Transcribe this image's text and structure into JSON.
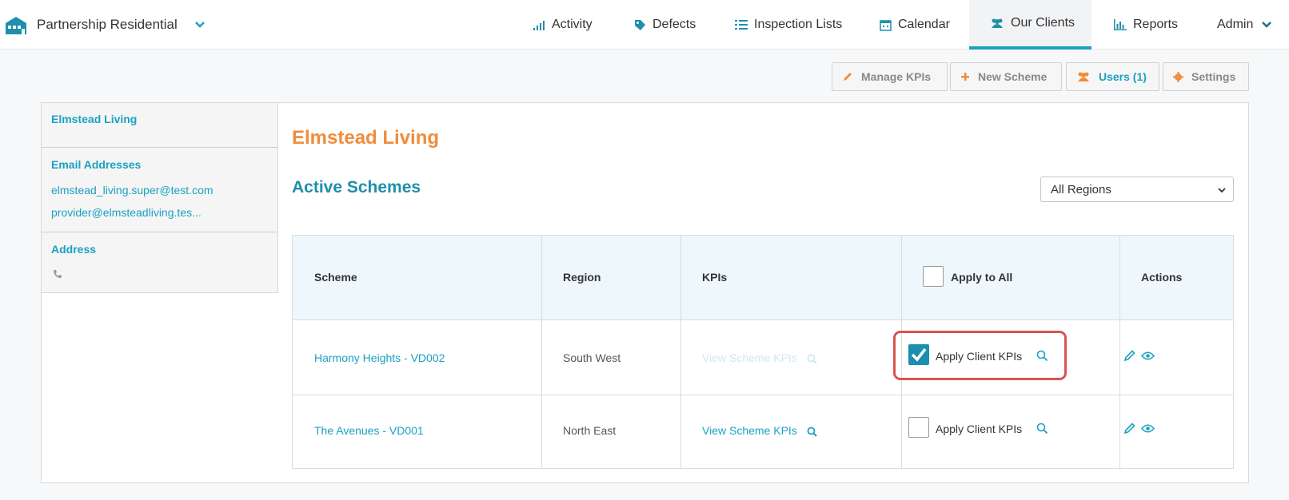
{
  "nav": {
    "org_name": "Partnership Residential",
    "items": [
      {
        "label": "Activity",
        "icon": "activity-icon"
      },
      {
        "label": "Defects",
        "icon": "tag-icon"
      },
      {
        "label": "Inspection Lists",
        "icon": "list-icon"
      },
      {
        "label": "Calendar",
        "icon": "calendar-icon"
      },
      {
        "label": "Our Clients",
        "icon": "users-icon",
        "active": true
      },
      {
        "label": "Reports",
        "icon": "bar-chart-icon"
      },
      {
        "label": "Admin",
        "icon": "chevron-down-icon"
      }
    ]
  },
  "toolbar": {
    "manage_kpis": "Manage KPIs",
    "new_scheme": "New Scheme",
    "users": "Users (1)",
    "settings": "Settings"
  },
  "sidebar": {
    "client_name": "Elmstead Living",
    "email_heading": "Email Addresses",
    "emails": [
      "elmstead_living.super@test.com",
      "provider@elmsteadliving.tes..."
    ],
    "address_heading": "Address"
  },
  "main": {
    "client_title": "Elmstead Living",
    "section_title": "Active Schemes",
    "region_select": "All Regions"
  },
  "table": {
    "headers": {
      "scheme": "Scheme",
      "region": "Region",
      "kpis": "KPIs",
      "apply_all": "Apply to All",
      "actions": "Actions"
    },
    "rows": [
      {
        "scheme": "Harmony Heights - VD002",
        "region": "South West",
        "kpis": "View Scheme KPIs",
        "apply": "Apply Client KPIs",
        "checked": true
      },
      {
        "scheme": "The Avenues - VD001",
        "region": "North East",
        "kpis": "View Scheme KPIs",
        "apply": "Apply Client KPIs",
        "checked": false
      }
    ]
  },
  "colors": {
    "accent": "#1aa1c3",
    "orange": "#f08c3c",
    "highlight": "#d9534f"
  }
}
